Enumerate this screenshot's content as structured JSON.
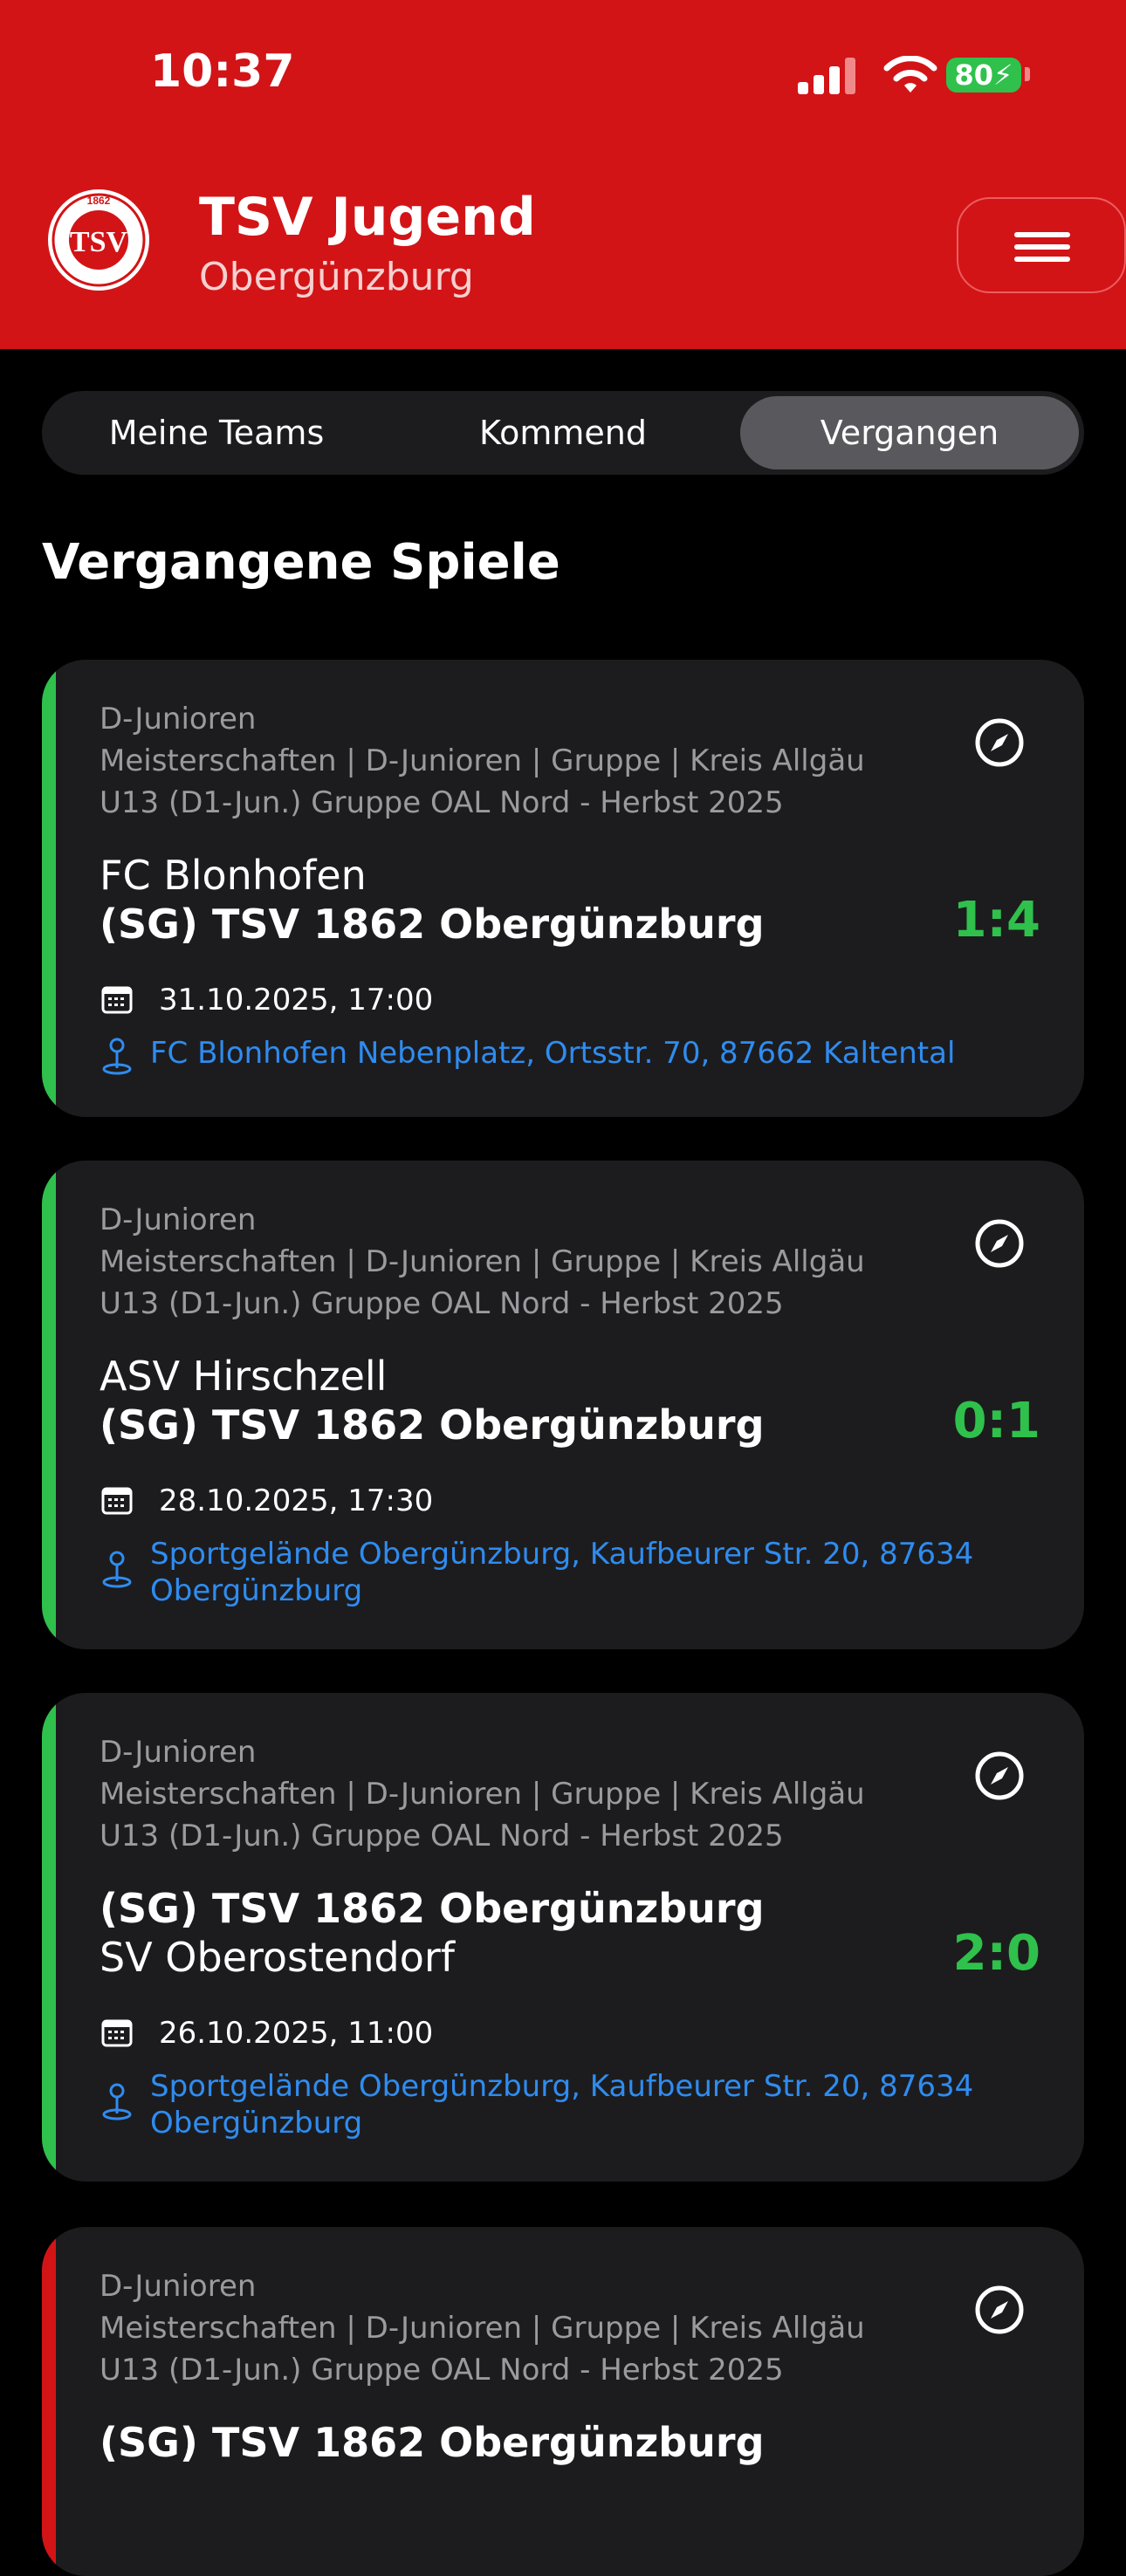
{
  "status": {
    "time": "10:37",
    "battery": "80"
  },
  "header": {
    "title": "TSV Jugend",
    "subtitle": "Obergünzburg",
    "logo_text": "TSV",
    "logo_year": "1862"
  },
  "tabs": [
    {
      "label": "Meine Teams",
      "active": false
    },
    {
      "label": "Kommend",
      "active": false
    },
    {
      "label": "Vergangen",
      "active": true
    }
  ],
  "section_title": "Vergangene Spiele",
  "games": [
    {
      "category": "D-Junioren",
      "league": "Meisterschaften | D-Junioren | Gruppe | Kreis Allgäu",
      "group": "U13 (D1-Jun.) Gruppe OAL Nord - Herbst 2025",
      "team1": "FC Blonhofen",
      "team2": "(SG) TSV 1862 Obergünzburg",
      "score": "1:4",
      "datetime": "31.10.2025, 17:00",
      "location": "FC Blonhofen Nebenplatz, Ortsstr. 70, 87662 Kaltental",
      "result_color": "#2fc14c"
    },
    {
      "category": "D-Junioren",
      "league": "Meisterschaften | D-Junioren | Gruppe | Kreis Allgäu",
      "group": "U13 (D1-Jun.) Gruppe OAL Nord - Herbst 2025",
      "team1": "ASV Hirschzell",
      "team2": "(SG) TSV 1862 Obergünzburg",
      "score": "0:1",
      "datetime": "28.10.2025, 17:30",
      "location_line1": "Sportgelände Obergünzburg, Kaufbeurer Str. 20, 87634",
      "location_line2": "Obergünzburg",
      "result_color": "#2fc14c"
    },
    {
      "category": "D-Junioren",
      "league": "Meisterschaften | D-Junioren | Gruppe | Kreis Allgäu",
      "group": "U13 (D1-Jun.) Gruppe OAL Nord - Herbst 2025",
      "team1": "(SG) TSV 1862 Obergünzburg",
      "team2": "SV Oberostendorf",
      "score": "2:0",
      "datetime": "26.10.2025, 11:00",
      "location_line1": "Sportgelände Obergünzburg, Kaufbeurer Str. 20, 87634",
      "location_line2": "Obergünzburg",
      "result_color": "#2fc14c"
    },
    {
      "category": "D-Junioren",
      "league": "Meisterschaften | D-Junioren | Gruppe | Kreis Allgäu",
      "group": "U13 (D1-Jun.) Gruppe OAL Nord - Herbst 2025",
      "team1": "(SG) TSV 1862 Obergünzburg",
      "result_color": "#d21417"
    }
  ]
}
